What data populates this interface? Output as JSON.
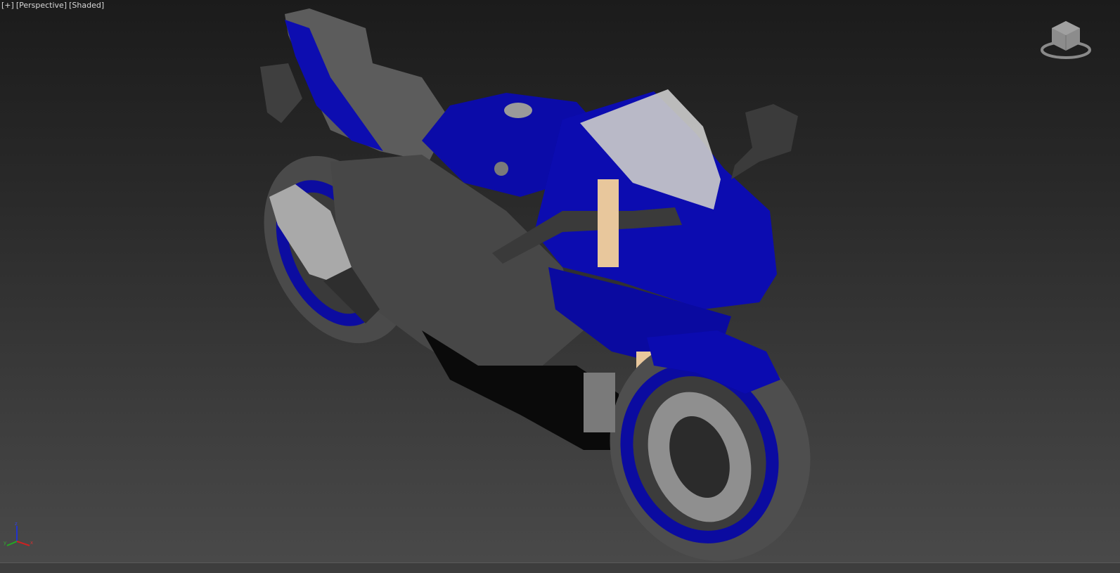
{
  "viewport": {
    "labels": {
      "plus": "[+]",
      "view": "[Perspective]",
      "shading": "[Shaded]"
    },
    "viewcube_icon": "viewcube-icon",
    "axis_gizmo": {
      "x": "x",
      "y": "y",
      "z": "z"
    },
    "colors": {
      "bike_blue": "#0b0ba8",
      "bike_gray": "#5a5a5a",
      "tire": "#4b4b4b",
      "background_top": "#1b1b1b",
      "background_bottom": "#4a4a4a"
    }
  }
}
